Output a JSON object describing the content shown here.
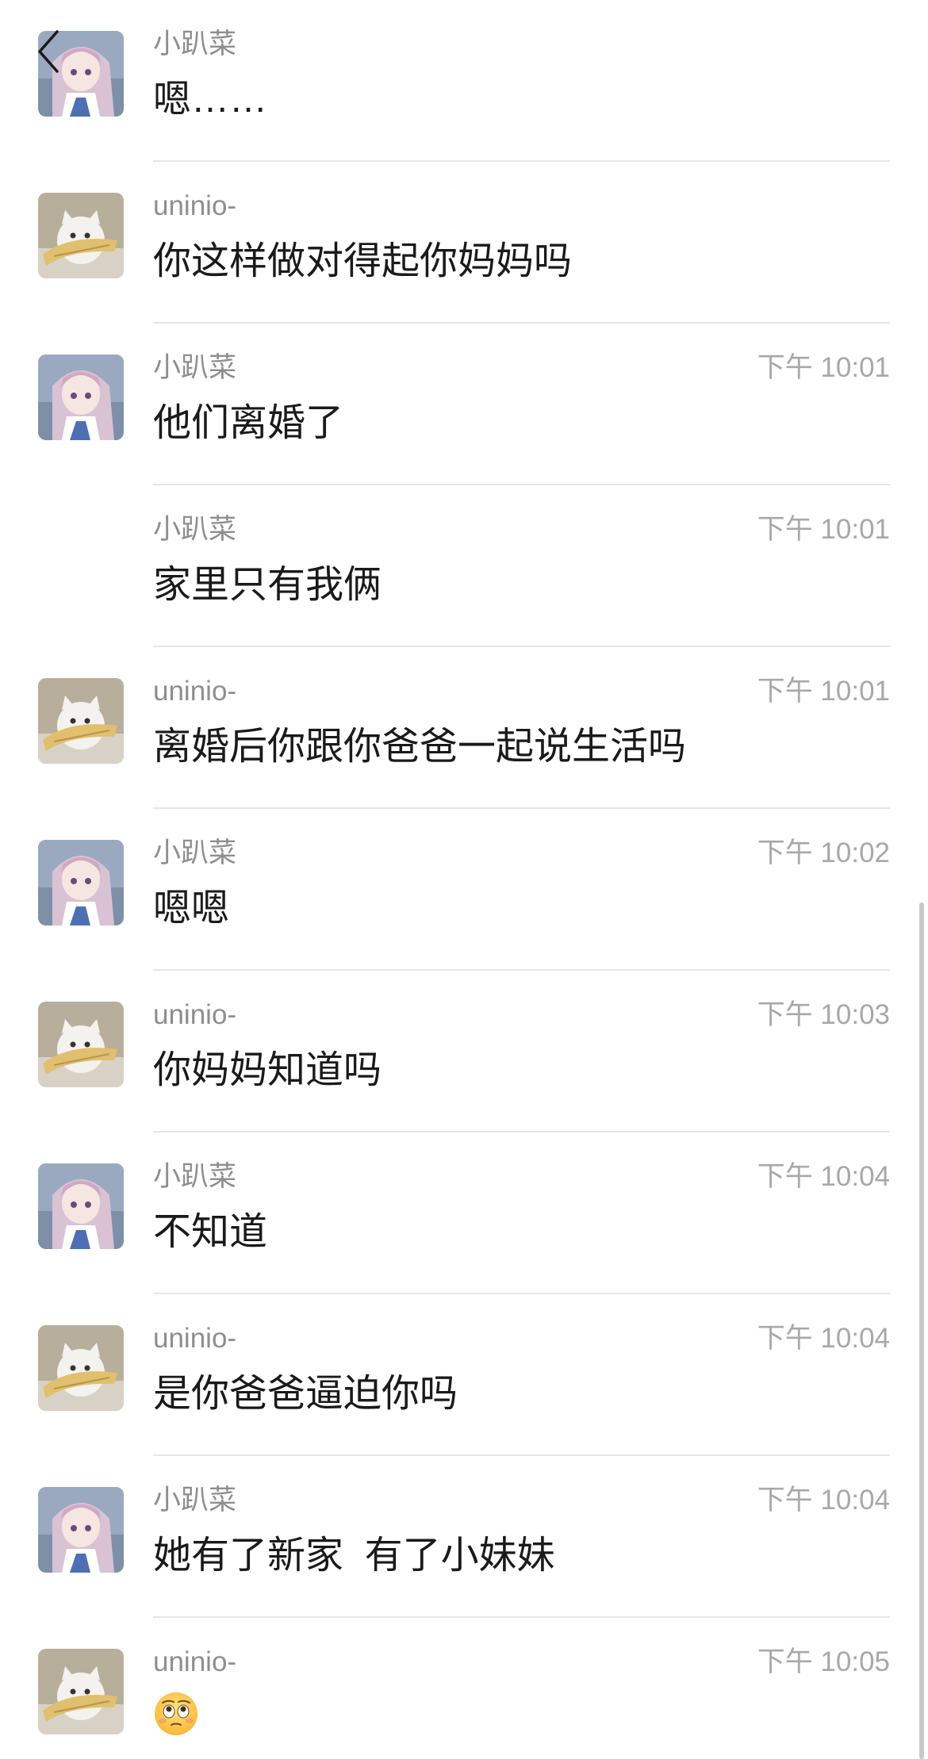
{
  "nav": {
    "back_icon": "chevron-left-icon"
  },
  "messages": [
    {
      "sender": "小趴菜",
      "time": "",
      "text": "嗯……",
      "avatar": "anime-girl"
    },
    {
      "sender": "uninio-",
      "time": "",
      "text": "你这样做对得起你妈妈吗",
      "avatar": "white-cat"
    },
    {
      "sender": "小趴菜",
      "time": "下午 10:01",
      "text": "他们离婚了",
      "avatar": "anime-girl"
    },
    {
      "sender": "小趴菜",
      "time": "下午 10:01",
      "text": "家里只有我俩",
      "avatar": ""
    },
    {
      "sender": "uninio-",
      "time": "下午 10:01",
      "text": "离婚后你跟你爸爸一起说生活吗",
      "avatar": "white-cat"
    },
    {
      "sender": "小趴菜",
      "time": "下午 10:02",
      "text": "嗯嗯",
      "avatar": "anime-girl"
    },
    {
      "sender": "uninio-",
      "time": "下午 10:03",
      "text": "你妈妈知道吗",
      "avatar": "white-cat"
    },
    {
      "sender": "小趴菜",
      "time": "下午 10:04",
      "text": "不知道",
      "avatar": "anime-girl"
    },
    {
      "sender": "uninio-",
      "time": "下午 10:04",
      "text": "是你爸爸逼迫你吗",
      "avatar": "white-cat"
    },
    {
      "sender": "小趴菜",
      "time": "下午 10:04",
      "text": "她有了新家  有了小妹妹",
      "avatar": "anime-girl"
    },
    {
      "sender": "uninio-",
      "time": "下午 10:05",
      "text": "",
      "emoji": "flushed-face-emoji",
      "avatar": "white-cat"
    }
  ],
  "colors": {
    "sender": "#8e8e8e",
    "time": "#a8a8a8",
    "text": "#1a1a1a",
    "divider": "#e6e6e6"
  }
}
